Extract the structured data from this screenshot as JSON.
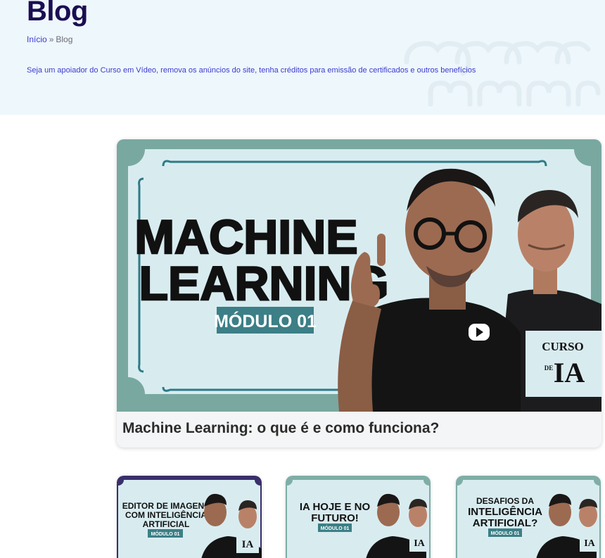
{
  "header": {
    "title": "Blog",
    "breadcrumb": {
      "home": "Início",
      "separator": "»",
      "current": "Blog"
    },
    "support_text": "Seja um apoiador do Curso em Vídeo, remova os anúncios do site, tenha créditos para emissão de certificados e outros benefícios"
  },
  "featured": {
    "thumb": {
      "line1": "MACHINE",
      "line2": "LEARNING",
      "module": "MÓDULO 01",
      "logo_top": "CURSO",
      "logo_de": "DE",
      "logo_ia": "IA"
    },
    "title": "Machine Learning: o que é e como funciona?"
  },
  "cards": [
    {
      "line1": "EDITOR DE IMAGENS",
      "line2": "COM INTELIGÊNCIA",
      "line3": "ARTIFICIAL",
      "module": "MÓDULO 01",
      "logo": "IA"
    },
    {
      "line1": "IA HOJE E NO",
      "line2": "FUTURO!",
      "module": "MÓDULO 01",
      "logo": "IA"
    },
    {
      "line1": "DESAFIOS DA",
      "line2": "INTELIGÊNCIA",
      "line3": "ARTIFICIAL?",
      "module": "MÓDULO 01",
      "logo": "IA"
    }
  ],
  "colors": {
    "title": "#1b0d52",
    "link": "#3b3bd1",
    "thumb_frame": "#7faea6",
    "thumb_panel": "#d8ecf0",
    "module_badge": "#3c7f86"
  }
}
